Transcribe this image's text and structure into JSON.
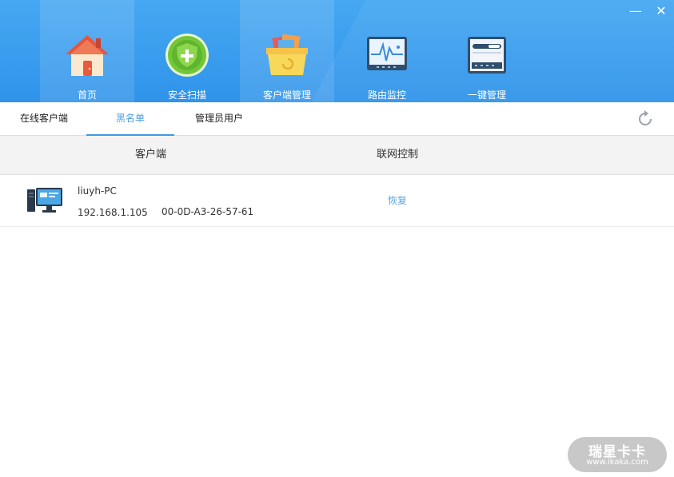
{
  "window": {
    "minimize_symbol": "—",
    "close_symbol": "✕"
  },
  "nav": {
    "items": [
      {
        "label": "首页",
        "icon": "house-icon"
      },
      {
        "label": "安全扫描",
        "icon": "shield-plus-icon"
      },
      {
        "label": "客户端管理",
        "icon": "folder-box-icon",
        "active": true
      },
      {
        "label": "路由监控",
        "icon": "monitor-pulse-icon"
      },
      {
        "label": "一键管理",
        "icon": "router-device-icon"
      }
    ]
  },
  "subtabs": {
    "items": [
      {
        "label": "在线客户端"
      },
      {
        "label": "黑名单",
        "active": true
      },
      {
        "label": "管理员用户"
      }
    ],
    "refresh_icon": "refresh-icon"
  },
  "table": {
    "headers": [
      "客户端",
      "联网控制"
    ],
    "rows": [
      {
        "hostname": "liuyh-PC",
        "ip": "192.168.1.105",
        "mac": "00-0D-A3-26-57-61",
        "action": "恢复",
        "icon": "desktop-pc-icon"
      }
    ]
  },
  "watermark": {
    "main": "瑞星卡卡",
    "url": "www.ikaka.com"
  },
  "colors": {
    "header_top": "#46a8f2",
    "header_bottom": "#2f93ea",
    "accent": "#3a99e8",
    "link": "#5aa6e0"
  }
}
